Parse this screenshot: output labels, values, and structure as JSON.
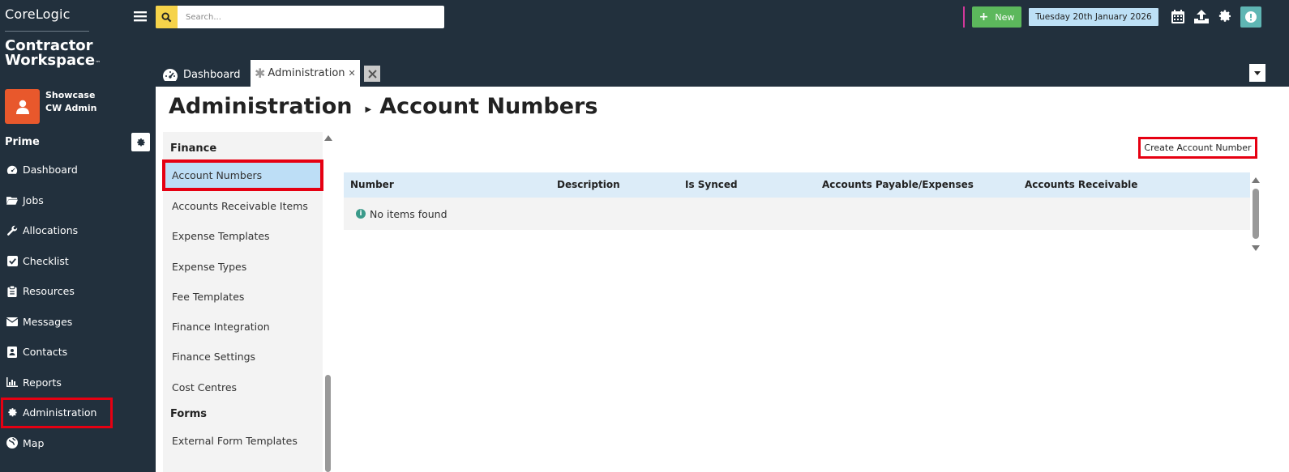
{
  "brand": {
    "company": "CoreLogic",
    "product_line1": "Contractor",
    "product_line2": "Workspace",
    "trademark": "™"
  },
  "user": {
    "line1": "Showcase",
    "line2": "CW Admin"
  },
  "sidebar": {
    "section": "Prime",
    "items": [
      {
        "label": "Dashboard",
        "icon": "gauge-icon"
      },
      {
        "label": "Jobs",
        "icon": "folder-icon"
      },
      {
        "label": "Allocations",
        "icon": "wrench-icon"
      },
      {
        "label": "Checklist",
        "icon": "check-square-icon"
      },
      {
        "label": "Resources",
        "icon": "clipboard-icon"
      },
      {
        "label": "Messages",
        "icon": "envelope-icon"
      },
      {
        "label": "Contacts",
        "icon": "address-book-icon"
      },
      {
        "label": "Reports",
        "icon": "bar-chart-icon"
      },
      {
        "label": "Administration",
        "icon": "gear-icon"
      },
      {
        "label": "Map",
        "icon": "globe-icon"
      }
    ]
  },
  "topbar": {
    "search_placeholder": "Search...",
    "new_label": "New",
    "date": "Tuesday 20th January 2026"
  },
  "tabs": [
    {
      "label": "Dashboard"
    },
    {
      "label": "Administration"
    }
  ],
  "page": {
    "breadcrumb_parent": "Administration",
    "title": "Account Numbers",
    "create_button": "Create Account Number"
  },
  "subnav": {
    "groups": [
      {
        "label": "Finance",
        "items": [
          "Account Numbers",
          "Accounts Receivable Items",
          "Expense Templates",
          "Expense Types",
          "Fee Templates",
          "Finance Integration",
          "Finance Settings",
          "Cost Centres"
        ]
      },
      {
        "label": "Forms",
        "items": [
          "External Form Templates"
        ]
      }
    ]
  },
  "grid": {
    "columns": [
      "Number",
      "Description",
      "Is Synced",
      "Accounts Payable/Expenses",
      "Accounts Receivable"
    ],
    "empty_message": "No items found"
  },
  "colors": {
    "sidebar_bg": "#22303d",
    "accent_red": "#e60012",
    "new_green": "#5cb85c",
    "avatar_orange": "#e8582c",
    "date_bg": "#bde0f6"
  }
}
